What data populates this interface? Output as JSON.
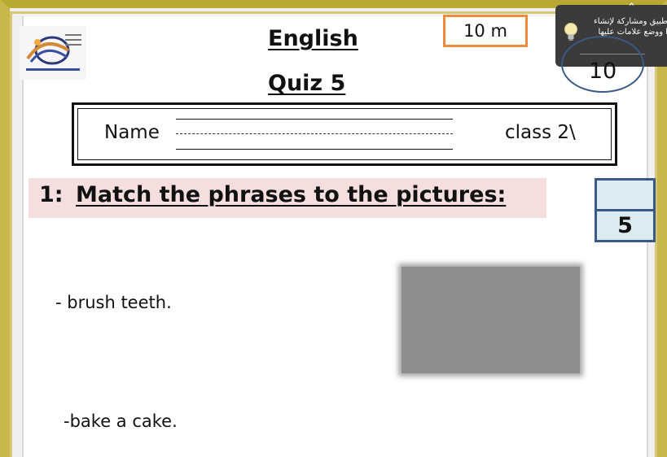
{
  "header": {
    "title": "English",
    "subtitle": "Quiz 5",
    "time_limit": "10 m",
    "total_score": "10"
  },
  "student_info": {
    "name_label": "Name",
    "class_label": "class 2\\"
  },
  "question": {
    "number": "1:",
    "instruction": "Match the phrases to the pictures:",
    "score": "5"
  },
  "phrases": [
    "- brush teeth.",
    "-bake a cake."
  ],
  "hint_popup": {
    "text_line1": "طبيق ومشاركة لإنشاء",
    "text_line2": "ا ووضع علامات عليها",
    "icon": "lightbulb-icon"
  },
  "colors": {
    "frame": "#c8b84a",
    "time_box_border": "#ee8a3b",
    "banner": "#f4dede",
    "score_box": "#dceaf2",
    "score_border": "#3a5a85"
  }
}
